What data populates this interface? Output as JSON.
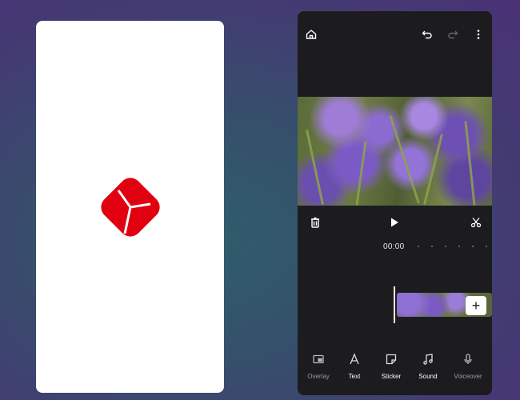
{
  "splash": {
    "logo_colors": {
      "primary": "#e1000f",
      "background": "#ffffff"
    },
    "logo_icon": "red-play-diamond-logo"
  },
  "editor": {
    "top_bar": {
      "home_icon": "home-icon",
      "undo_icon": "undo-icon",
      "redo_icon": "redo-icon",
      "more_icon": "more-vertical-icon"
    },
    "controls": {
      "delete_icon": "trash-icon",
      "play_icon": "play-icon",
      "split_icon": "scissors-icon"
    },
    "timeline": {
      "time": "00:00",
      "add_label": "+"
    },
    "tools": [
      {
        "label": "Overlay",
        "icon": "overlay-icon"
      },
      {
        "label": "Text",
        "icon": "text-icon"
      },
      {
        "label": "Sticker",
        "icon": "sticker-icon"
      },
      {
        "label": "Sound",
        "icon": "music-note-icon"
      },
      {
        "label": "Voiceover",
        "icon": "microphone-icon"
      }
    ]
  }
}
